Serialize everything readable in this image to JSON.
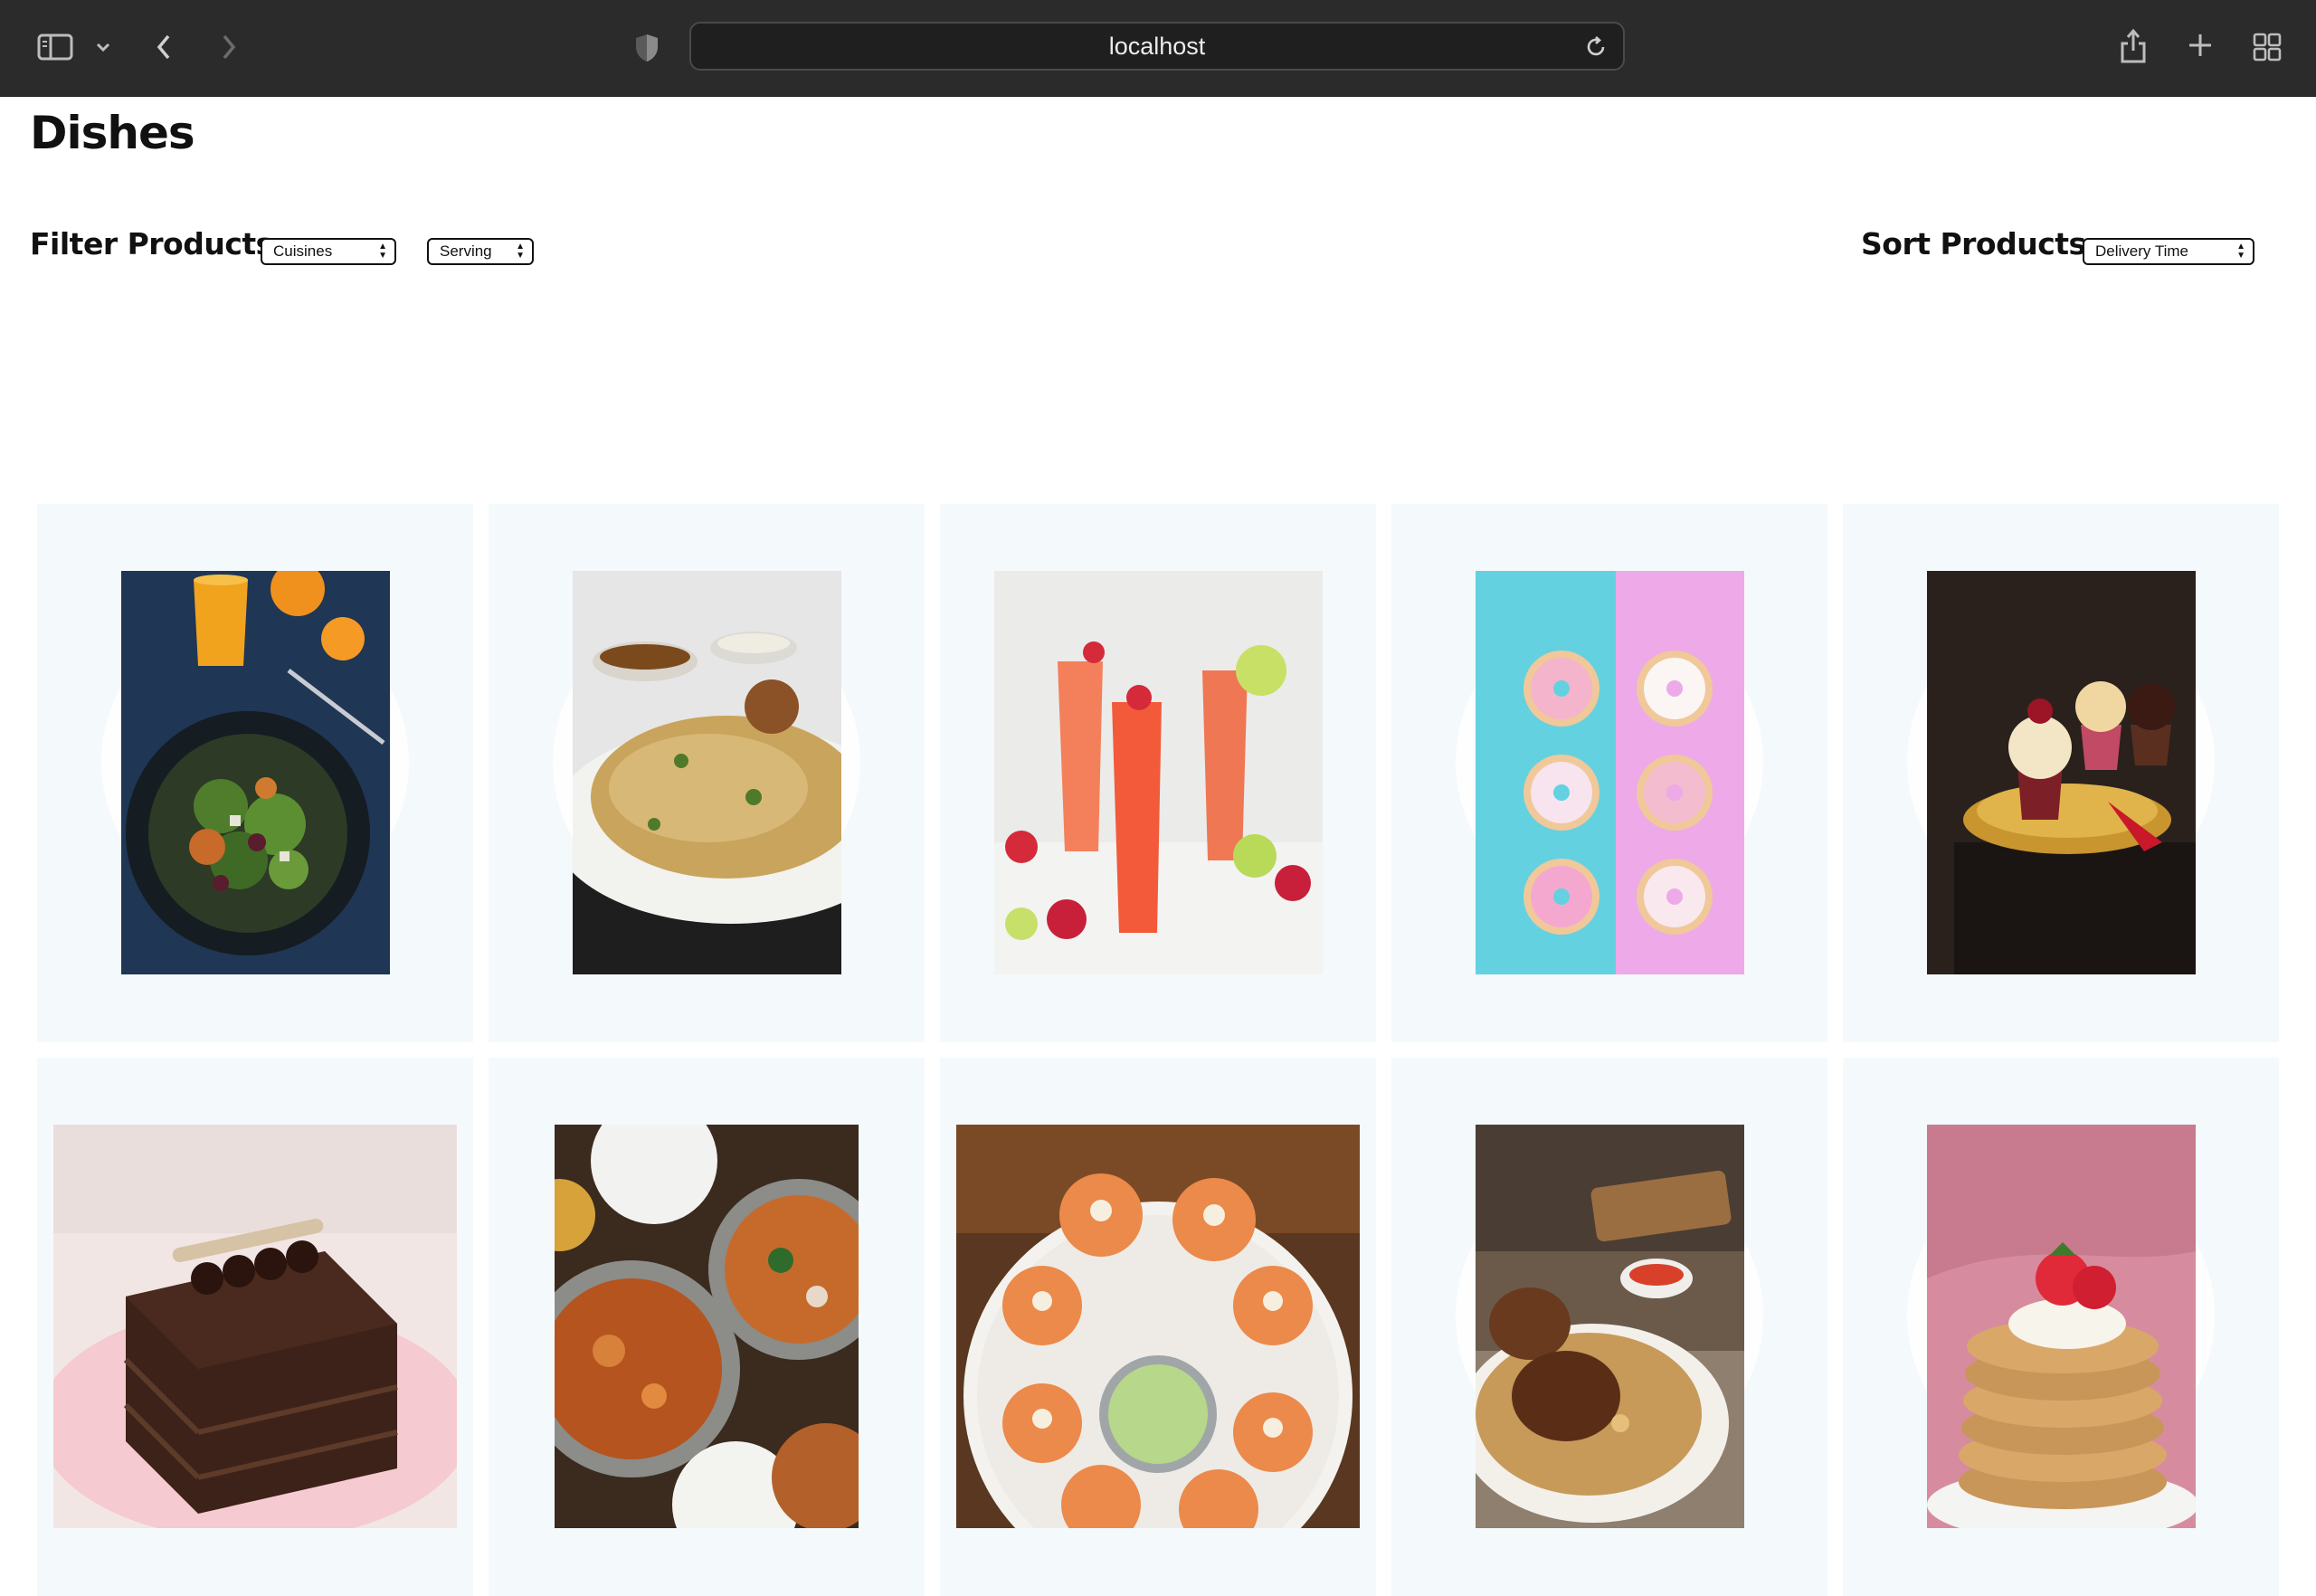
{
  "browser": {
    "url": "localhost",
    "icons": [
      "sidebar-icon",
      "chevron-down-icon",
      "back-icon",
      "forward-icon",
      "shield-icon",
      "reload-icon",
      "share-icon",
      "new-tab-icon",
      "tab-overview-icon"
    ]
  },
  "page": {
    "title": "Dishes"
  },
  "filter": {
    "label": "Filter Products:",
    "cuisines_value": "Cuisines",
    "serving_value": "Serving"
  },
  "sort": {
    "label": "Sort Products:",
    "value": "Delivery Time"
  },
  "dishes": [
    {
      "image": "salad-image"
    },
    {
      "image": "biryani-image"
    },
    {
      "image": "strawberry-drinks-image"
    },
    {
      "image": "donuts-image"
    },
    {
      "image": "cupcakes-image"
    },
    {
      "image": "chocolate-cake-image"
    },
    {
      "image": "curry-bowls-image"
    },
    {
      "image": "stuffed-idli-image"
    },
    {
      "image": "chicken-biryani-image"
    },
    {
      "image": "pancakes-image"
    }
  ],
  "colors": {
    "chrome_bg": "#2b2b2b",
    "card_bg": "#f4f9fc",
    "text": "#111111"
  }
}
